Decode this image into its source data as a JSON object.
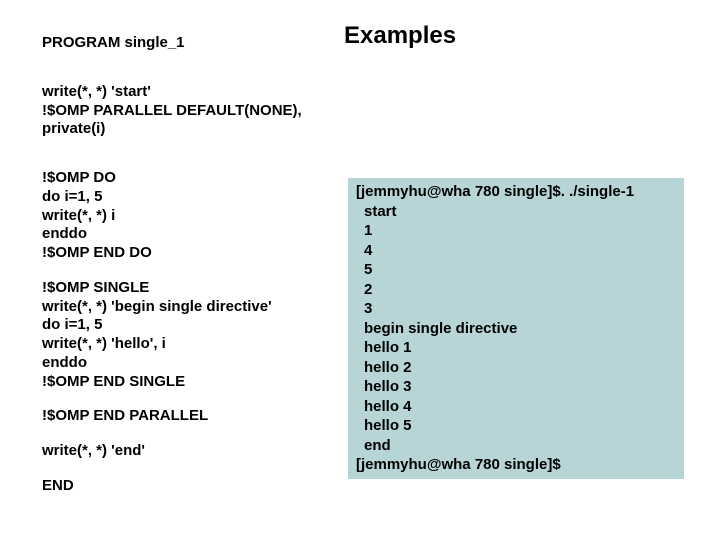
{
  "title": "Examples",
  "code": {
    "program": "PROGRAM single_1",
    "block1_l1": "write(*, *) 'start'",
    "block1_l2": "!$OMP PARALLEL DEFAULT(NONE),",
    "block1_l3": "private(i)",
    "block2_l1": "!$OMP DO",
    "block2_l2": "do i=1, 5",
    "block2_l3": "write(*, *) i",
    "block2_l4": "enddo",
    "block2_l5": "!$OMP END DO",
    "block3_l1": "!$OMP SINGLE",
    "block3_l2": "write(*, *) 'begin single directive'",
    "block3_l3": "do i=1, 5",
    "block3_l4": "write(*, *) 'hello', i",
    "block3_l5": "enddo",
    "block3_l6": "!$OMP END SINGLE",
    "end_parallel": "!$OMP END PARALLEL",
    "write_end": "write(*, *) 'end'",
    "end": "END"
  },
  "output": {
    "l0": "[jemmyhu@wha 780 single]$. ./single-1",
    "l1": "start",
    "l2": "1",
    "l3": "4",
    "l4": "5",
    "l5": "2",
    "l6": "3",
    "l7": "begin single directive",
    "l8": "hello 1",
    "l9": "hello 2",
    "l10": "hello 3",
    "l11": "hello 4",
    "l12": "hello 5",
    "l13": "end",
    "l14": "[jemmyhu@wha 780 single]$"
  }
}
